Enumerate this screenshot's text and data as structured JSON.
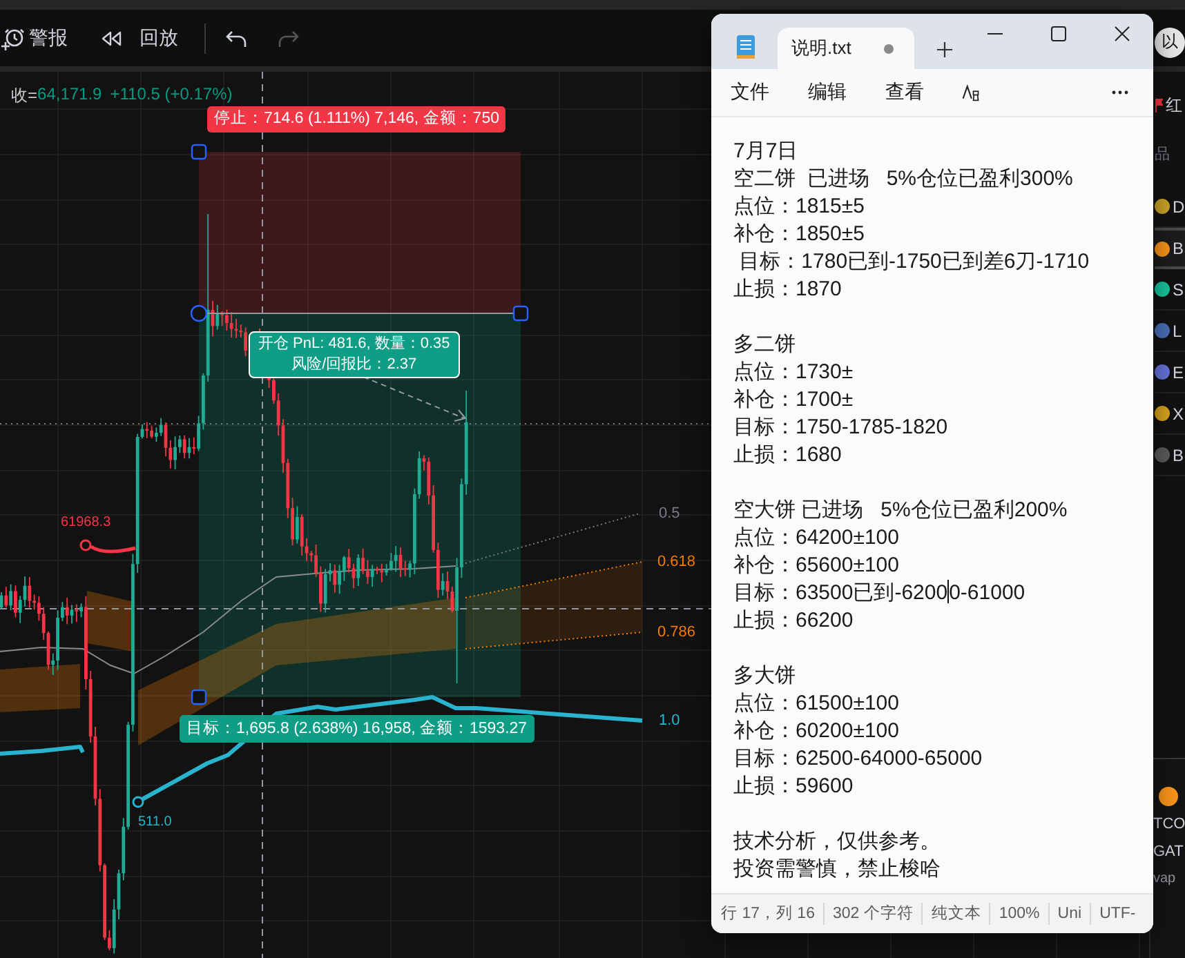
{
  "toolbar": {
    "tools": [
      {
        "kind": "alert",
        "label": "警报"
      },
      {
        "kind": "replay",
        "label": "回放"
      }
    ],
    "history": [
      {
        "kind": "undo",
        "disabled": false
      },
      {
        "kind": "redo",
        "disabled": true
      }
    ],
    "profile_button": "以"
  },
  "chart": {
    "legend": {
      "label": "收=",
      "value": "64,171.9",
      "change": "+110.5 (+0.17%)"
    },
    "position": {
      "stop_label": "停止：714.6 (1.111%) 7,146, 金额：750",
      "entry_lines": [
        "开仓 PnL: 481.6, 数量：0.35",
        "风险/回报比：2.37"
      ],
      "target_label": "目标：1,695.8 (2.638%) 16,958, 金额：1593.27"
    },
    "fib_levels": [
      {
        "label": "0.5",
        "color": "#787b86"
      },
      {
        "label": "0.618",
        "color": "#f57c00"
      },
      {
        "label": "0.786",
        "color": "#f57c00"
      },
      {
        "label": "1.0",
        "color": "#2ab3cf"
      }
    ],
    "price_markers": [
      {
        "label": "61968.3",
        "color": "#f23645"
      },
      {
        "label": "511.0",
        "color": "#2ab3cf"
      }
    ]
  },
  "watchlist": {
    "filter": "红",
    "header": "品",
    "items": [
      {
        "symbol": "D",
        "color": "#c9a227",
        "selected": false
      },
      {
        "symbol": "B",
        "color": "#f7931a",
        "selected": true
      },
      {
        "symbol": "S",
        "color": "#19c39c",
        "selected": false
      },
      {
        "symbol": "L",
        "color": "#4a6fb5",
        "selected": false
      },
      {
        "symbol": "E",
        "color": "#6474d8",
        "selected": false
      },
      {
        "symbol": "X",
        "color": "#d6a21e",
        "selected": false
      },
      {
        "symbol": "B",
        "color": "#5a5a5a",
        "selected": false
      }
    ],
    "detail": {
      "lines": [
        "TCO",
        "GAT"
      ],
      "tag": "vap"
    }
  },
  "notepad": {
    "tab": {
      "title": "说明.txt",
      "unsaved": true
    },
    "menu": [
      "文件",
      "编辑",
      "查看"
    ],
    "blocks": [
      {
        "lines": [
          {
            "text": "7月7日",
            "caret": false
          },
          {
            "text": "空二饼  已进场   5%仓位已盈利300%",
            "caret": false
          },
          {
            "text": "点位：1815±5",
            "caret": false
          },
          {
            "text": "补仓：1850±5",
            "caret": false
          },
          {
            "text": " 目标：1780已到-1750已到差6刀-1710",
            "caret": false
          },
          {
            "text": "止损：1870",
            "caret": false
          }
        ]
      },
      {
        "lines": [
          {
            "text": "多二饼",
            "caret": false
          },
          {
            "text": "点位：1730±",
            "caret": false
          },
          {
            "text": "补仓：1700±",
            "caret": false
          },
          {
            "text": "目标：1750-1785-1820",
            "caret": false
          },
          {
            "text": "止损：1680",
            "caret": false
          }
        ]
      },
      {
        "lines": [
          {
            "text": "空大饼 已进场   5%仓位已盈利200%",
            "caret": false
          },
          {
            "text": "点位：64200±100",
            "caret": false
          },
          {
            "text": "补仓：65600±100",
            "caret": false
          },
          {
            "text": "目标：63500已到-6200",
            "caret": true,
            "after_caret": "0-61000"
          },
          {
            "text": "止损：66200",
            "caret": false
          }
        ]
      },
      {
        "lines": [
          {
            "text": "多大饼",
            "caret": false
          },
          {
            "text": "点位：61500±100",
            "caret": false
          },
          {
            "text": "补仓：60200±100",
            "caret": false
          },
          {
            "text": "目标：62500-64000-65000",
            "caret": false
          },
          {
            "text": "止损：59600",
            "caret": false
          }
        ]
      },
      {
        "lines": [
          {
            "text": "技术分析，仅供参考。",
            "caret": false
          },
          {
            "text": "投资需警慎，禁止梭哈",
            "caret": false
          }
        ]
      }
    ],
    "status": [
      "行 17，列 16",
      "302 个字符",
      "纯文本",
      "100%",
      "Uni",
      "UTF-"
    ]
  }
}
